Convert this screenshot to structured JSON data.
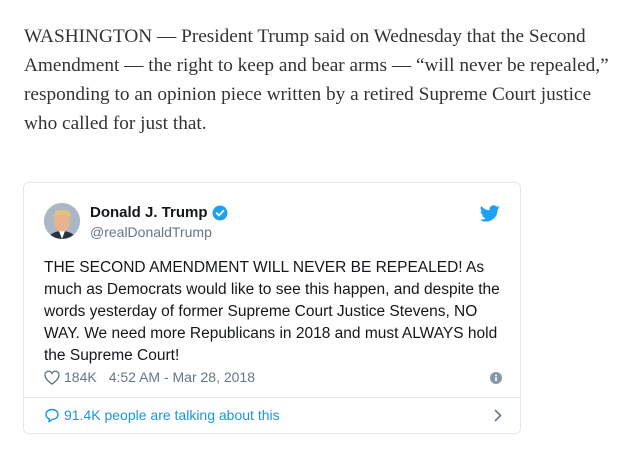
{
  "article": {
    "paragraph": "WASHINGTON — President Trump said on Wednesday that the Second Amendment — the right to keep and bear arms — “will never be repealed,” responding to an opinion piece written by a retired Supreme Court justice who called for just that."
  },
  "tweet": {
    "display_name": "Donald J. Trump",
    "handle": "@realDonaldTrump",
    "text": "THE SECOND AMENDMENT WILL NEVER BE REPEALED! As much as Democrats would like to see this happen, and despite the words yesterday of former Supreme Court Justice Stevens, NO WAY. We need more Republicans in 2018 and must ALWAYS hold the Supreme Court!",
    "like_count": "184K",
    "timestamp": "4:52 AM - Mar 28, 2018",
    "talking_label": "91.4K people are talking about this",
    "icons": [
      "heart-icon",
      "info-icon",
      "comment-icon",
      "chevron-right-icon",
      "twitter-bird-icon",
      "verified-badge-icon"
    ]
  },
  "colors": {
    "twitter_blue": "#1da1f2",
    "link_blue": "#1b95e0",
    "muted_gray": "#657786",
    "border": "#e1e8ed",
    "article_text": "#333333"
  }
}
